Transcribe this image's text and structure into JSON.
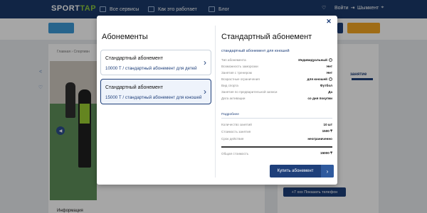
{
  "header": {
    "logo_sport": "SPORT",
    "logo_tap": "TAP",
    "nav": [
      "Все сервисы",
      "Как это работает",
      "Блог"
    ],
    "login": "Войти",
    "city": "Шымкент"
  },
  "modal": {
    "left_title": "Абонементы",
    "cards": [
      {
        "name": "Стандартный абонемент",
        "price": "10000 Т / стандартный абонемент для детей"
      },
      {
        "name": "Стандартный абонемент",
        "price": "15000 Т / стандартный абонемент для юношей"
      }
    ],
    "detail": {
      "title": "Стандартный абонемент",
      "subtitle": "стандартный абонемент для юношей",
      "rows": [
        {
          "k": "Тип абонемента",
          "v": "Индивидуальный",
          "help": true
        },
        {
          "k": "Возможность заморозки",
          "v": "Нет"
        },
        {
          "k": "Занятия с тренером",
          "v": "Нет"
        },
        {
          "k": "Возрастные ограничения",
          "v": "для юношей",
          "help": true
        },
        {
          "k": "Вид спорта",
          "v": "Футбол"
        },
        {
          "k": "Занятия по предварительной записи",
          "v": "Да"
        },
        {
          "k": "Дата активации",
          "v": "со дня покупки"
        }
      ],
      "more": "Подробнее",
      "rows2": [
        {
          "k": "Количество занятий",
          "v": "10 шт"
        },
        {
          "k": "Стоимость занятия",
          "v": "1500 ₸"
        },
        {
          "k": "Срок действия",
          "v": "неограниченно"
        }
      ],
      "total_k": "Общая стоимость",
      "total_v": "15000 ₸",
      "buy": "Купить абонемент"
    }
  },
  "background": {
    "crumbs": "Главная  ›  Спортивн",
    "phone": "+7 xxx Показать телефон",
    "info": "Информация",
    "right_title": "занятие"
  },
  "colors": {
    "navy": "#1e3f7a",
    "header": "#1b3a6b",
    "green": "#8cc63f",
    "orange": "#f5a623"
  }
}
